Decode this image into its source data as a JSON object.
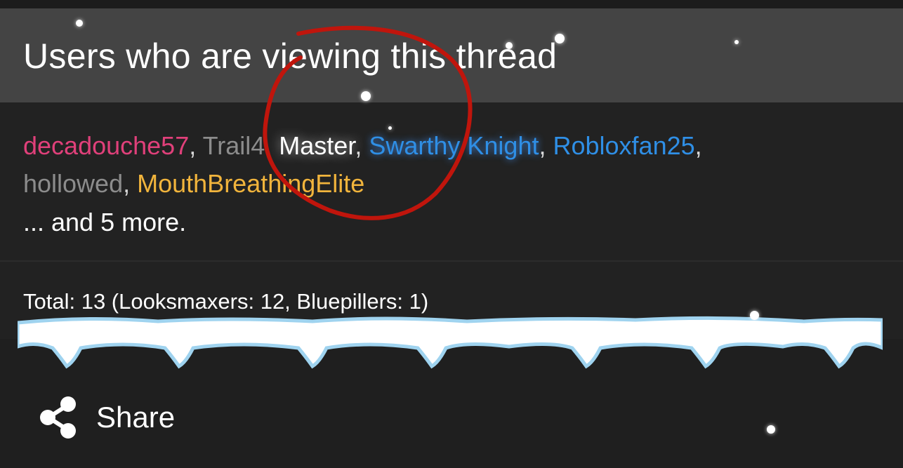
{
  "header": {
    "title": "Users who are viewing this thread"
  },
  "viewers": {
    "line1": [
      {
        "name": "decadouche57",
        "sep": ", "
      },
      {
        "name": "Trail4",
        "sep": ", "
      },
      {
        "name": "Master",
        "sep": ", "
      },
      {
        "name": "Swarthy Knight",
        "sep": ", "
      },
      {
        "name": "Robloxfan25",
        "sep": ","
      }
    ],
    "line2": [
      {
        "name": "hollowed",
        "sep": ", "
      },
      {
        "name": "MouthBreathingElite",
        "sep": ""
      }
    ],
    "more": "... and 5 more."
  },
  "totals": "Total: 13 (Looksmaxers: 12, Bluepillers: 1)",
  "share": {
    "label": "Share",
    "icon": "share-icon"
  },
  "colors": {
    "header_bg": "#444444",
    "body_bg": "#222222",
    "pink": "#e0407a",
    "grey": "#8c8c8c",
    "blue": "#2f8fe6",
    "gold": "#f1b43c",
    "annotation_red": "#c0150c"
  }
}
